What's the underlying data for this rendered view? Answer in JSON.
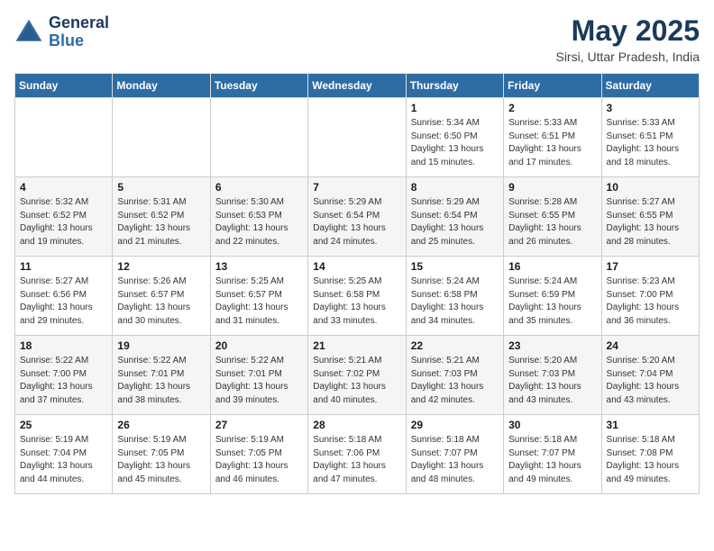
{
  "logo": {
    "text_general": "General",
    "text_blue": "Blue"
  },
  "title": "May 2025",
  "subtitle": "Sirsi, Uttar Pradesh, India",
  "days_of_week": [
    "Sunday",
    "Monday",
    "Tuesday",
    "Wednesday",
    "Thursday",
    "Friday",
    "Saturday"
  ],
  "weeks": [
    [
      {
        "day": "",
        "sunrise": "",
        "sunset": "",
        "daylight": ""
      },
      {
        "day": "",
        "sunrise": "",
        "sunset": "",
        "daylight": ""
      },
      {
        "day": "",
        "sunrise": "",
        "sunset": "",
        "daylight": ""
      },
      {
        "day": "",
        "sunrise": "",
        "sunset": "",
        "daylight": ""
      },
      {
        "day": "1",
        "sunrise": "Sunrise: 5:34 AM",
        "sunset": "Sunset: 6:50 PM",
        "daylight": "Daylight: 13 hours and 15 minutes."
      },
      {
        "day": "2",
        "sunrise": "Sunrise: 5:33 AM",
        "sunset": "Sunset: 6:51 PM",
        "daylight": "Daylight: 13 hours and 17 minutes."
      },
      {
        "day": "3",
        "sunrise": "Sunrise: 5:33 AM",
        "sunset": "Sunset: 6:51 PM",
        "daylight": "Daylight: 13 hours and 18 minutes."
      }
    ],
    [
      {
        "day": "4",
        "sunrise": "Sunrise: 5:32 AM",
        "sunset": "Sunset: 6:52 PM",
        "daylight": "Daylight: 13 hours and 19 minutes."
      },
      {
        "day": "5",
        "sunrise": "Sunrise: 5:31 AM",
        "sunset": "Sunset: 6:52 PM",
        "daylight": "Daylight: 13 hours and 21 minutes."
      },
      {
        "day": "6",
        "sunrise": "Sunrise: 5:30 AM",
        "sunset": "Sunset: 6:53 PM",
        "daylight": "Daylight: 13 hours and 22 minutes."
      },
      {
        "day": "7",
        "sunrise": "Sunrise: 5:29 AM",
        "sunset": "Sunset: 6:54 PM",
        "daylight": "Daylight: 13 hours and 24 minutes."
      },
      {
        "day": "8",
        "sunrise": "Sunrise: 5:29 AM",
        "sunset": "Sunset: 6:54 PM",
        "daylight": "Daylight: 13 hours and 25 minutes."
      },
      {
        "day": "9",
        "sunrise": "Sunrise: 5:28 AM",
        "sunset": "Sunset: 6:55 PM",
        "daylight": "Daylight: 13 hours and 26 minutes."
      },
      {
        "day": "10",
        "sunrise": "Sunrise: 5:27 AM",
        "sunset": "Sunset: 6:55 PM",
        "daylight": "Daylight: 13 hours and 28 minutes."
      }
    ],
    [
      {
        "day": "11",
        "sunrise": "Sunrise: 5:27 AM",
        "sunset": "Sunset: 6:56 PM",
        "daylight": "Daylight: 13 hours and 29 minutes."
      },
      {
        "day": "12",
        "sunrise": "Sunrise: 5:26 AM",
        "sunset": "Sunset: 6:57 PM",
        "daylight": "Daylight: 13 hours and 30 minutes."
      },
      {
        "day": "13",
        "sunrise": "Sunrise: 5:25 AM",
        "sunset": "Sunset: 6:57 PM",
        "daylight": "Daylight: 13 hours and 31 minutes."
      },
      {
        "day": "14",
        "sunrise": "Sunrise: 5:25 AM",
        "sunset": "Sunset: 6:58 PM",
        "daylight": "Daylight: 13 hours and 33 minutes."
      },
      {
        "day": "15",
        "sunrise": "Sunrise: 5:24 AM",
        "sunset": "Sunset: 6:58 PM",
        "daylight": "Daylight: 13 hours and 34 minutes."
      },
      {
        "day": "16",
        "sunrise": "Sunrise: 5:24 AM",
        "sunset": "Sunset: 6:59 PM",
        "daylight": "Daylight: 13 hours and 35 minutes."
      },
      {
        "day": "17",
        "sunrise": "Sunrise: 5:23 AM",
        "sunset": "Sunset: 7:00 PM",
        "daylight": "Daylight: 13 hours and 36 minutes."
      }
    ],
    [
      {
        "day": "18",
        "sunrise": "Sunrise: 5:22 AM",
        "sunset": "Sunset: 7:00 PM",
        "daylight": "Daylight: 13 hours and 37 minutes."
      },
      {
        "day": "19",
        "sunrise": "Sunrise: 5:22 AM",
        "sunset": "Sunset: 7:01 PM",
        "daylight": "Daylight: 13 hours and 38 minutes."
      },
      {
        "day": "20",
        "sunrise": "Sunrise: 5:22 AM",
        "sunset": "Sunset: 7:01 PM",
        "daylight": "Daylight: 13 hours and 39 minutes."
      },
      {
        "day": "21",
        "sunrise": "Sunrise: 5:21 AM",
        "sunset": "Sunset: 7:02 PM",
        "daylight": "Daylight: 13 hours and 40 minutes."
      },
      {
        "day": "22",
        "sunrise": "Sunrise: 5:21 AM",
        "sunset": "Sunset: 7:03 PM",
        "daylight": "Daylight: 13 hours and 42 minutes."
      },
      {
        "day": "23",
        "sunrise": "Sunrise: 5:20 AM",
        "sunset": "Sunset: 7:03 PM",
        "daylight": "Daylight: 13 hours and 43 minutes."
      },
      {
        "day": "24",
        "sunrise": "Sunrise: 5:20 AM",
        "sunset": "Sunset: 7:04 PM",
        "daylight": "Daylight: 13 hours and 43 minutes."
      }
    ],
    [
      {
        "day": "25",
        "sunrise": "Sunrise: 5:19 AM",
        "sunset": "Sunset: 7:04 PM",
        "daylight": "Daylight: 13 hours and 44 minutes."
      },
      {
        "day": "26",
        "sunrise": "Sunrise: 5:19 AM",
        "sunset": "Sunset: 7:05 PM",
        "daylight": "Daylight: 13 hours and 45 minutes."
      },
      {
        "day": "27",
        "sunrise": "Sunrise: 5:19 AM",
        "sunset": "Sunset: 7:05 PM",
        "daylight": "Daylight: 13 hours and 46 minutes."
      },
      {
        "day": "28",
        "sunrise": "Sunrise: 5:18 AM",
        "sunset": "Sunset: 7:06 PM",
        "daylight": "Daylight: 13 hours and 47 minutes."
      },
      {
        "day": "29",
        "sunrise": "Sunrise: 5:18 AM",
        "sunset": "Sunset: 7:07 PM",
        "daylight": "Daylight: 13 hours and 48 minutes."
      },
      {
        "day": "30",
        "sunrise": "Sunrise: 5:18 AM",
        "sunset": "Sunset: 7:07 PM",
        "daylight": "Daylight: 13 hours and 49 minutes."
      },
      {
        "day": "31",
        "sunrise": "Sunrise: 5:18 AM",
        "sunset": "Sunset: 7:08 PM",
        "daylight": "Daylight: 13 hours and 49 minutes."
      }
    ]
  ]
}
